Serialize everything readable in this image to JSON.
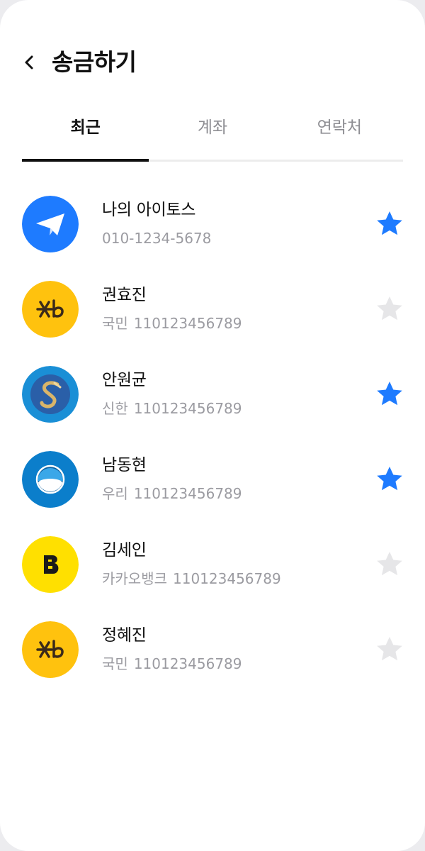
{
  "header": {
    "title": "송금하기"
  },
  "tabs": [
    {
      "label": "최근",
      "active": true
    },
    {
      "label": "계좌",
      "active": false
    },
    {
      "label": "연락처",
      "active": false
    }
  ],
  "colors": {
    "accent": "#1e7bff",
    "star_off": "#e6e6e8",
    "kb": "#ffc20e",
    "shinhan": "#1a8fd6",
    "woori": "#0b7ecb",
    "kakao": "#ffe000"
  },
  "recipients": [
    {
      "name": "나의 아이토스",
      "bank": "",
      "account": "010-1234-5678",
      "icon": "paper-plane-icon",
      "favorite": true
    },
    {
      "name": "권효진",
      "bank": "국민",
      "account": "110123456789",
      "icon": "kb-bank-logo-icon",
      "favorite": false
    },
    {
      "name": "안원균",
      "bank": "신한",
      "account": "110123456789",
      "icon": "shinhan-bank-logo-icon",
      "favorite": true
    },
    {
      "name": "남동현",
      "bank": "우리",
      "account": "110123456789",
      "icon": "woori-bank-logo-icon",
      "favorite": true
    },
    {
      "name": "김세인",
      "bank": "카카오뱅크",
      "account": "110123456789",
      "icon": "kakaobank-logo-icon",
      "favorite": false
    },
    {
      "name": "정혜진",
      "bank": "국민",
      "account": "110123456789",
      "icon": "kb-bank-logo-icon",
      "favorite": false
    }
  ]
}
